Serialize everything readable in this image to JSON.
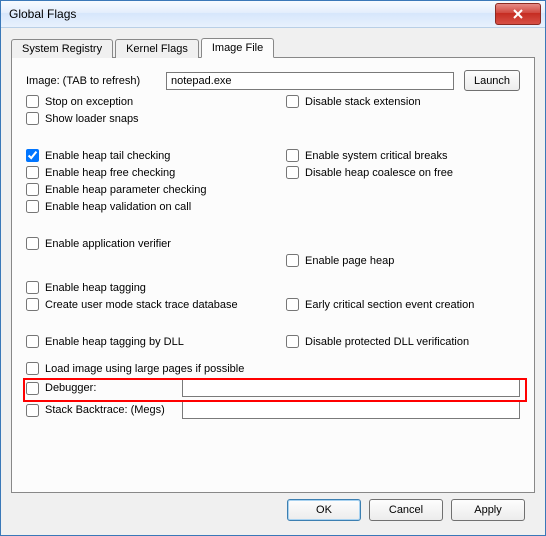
{
  "title": "Global Flags",
  "tabs": {
    "t0": "System Registry",
    "t1": "Kernel Flags",
    "t2": "Image File"
  },
  "img": {
    "label": "Image: (TAB to refresh)",
    "value": "notepad.exe",
    "launch": "Launch"
  },
  "opts": {
    "stop_exc": "Stop on exception",
    "loader_snaps": "Show loader snaps",
    "dis_stack_ext": "Disable stack extension",
    "heap_tail": "Enable heap tail checking",
    "heap_free": "Enable heap free checking",
    "heap_param": "Enable heap parameter checking",
    "heap_valid": "Enable heap validation on call",
    "sys_crit": "Enable system critical breaks",
    "heap_coalesce": "Disable heap coalesce on free",
    "app_verifier": "Enable application verifier",
    "page_heap": "Enable page heap",
    "heap_tagging": "Enable heap tagging",
    "user_trace_db": "Create user mode stack trace database",
    "early_crit": "Early critical section event creation",
    "heap_tag_dll": "Enable heap tagging by DLL",
    "dis_prot_dll": "Disable protected DLL verification",
    "large_pages": "Load image using large pages if possible",
    "debugger": "Debugger:",
    "stack_bt": "Stack Backtrace: (Megs)"
  },
  "buttons": {
    "ok": "OK",
    "cancel": "Cancel",
    "apply": "Apply"
  }
}
